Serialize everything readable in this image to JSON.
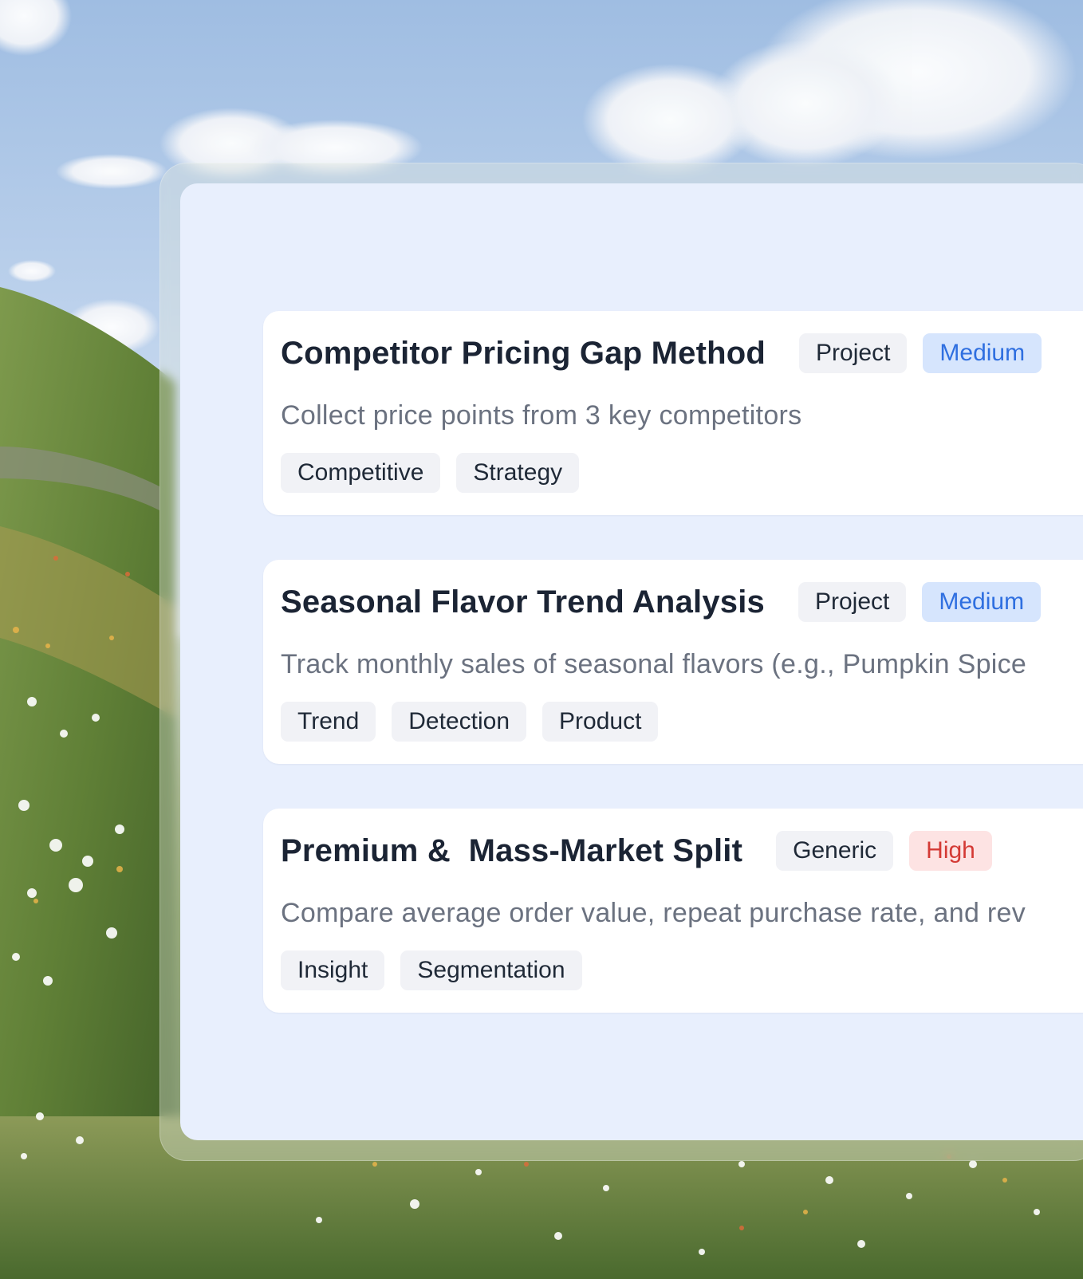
{
  "cards": [
    {
      "title": "Competitor Pricing Gap Method",
      "type_badge": "Project",
      "priority_badge": "Medium",
      "priority_color": "#2f6fe0",
      "description": "Collect price points from 3 key competitors",
      "tags": [
        "Competitive",
        "Strategy"
      ]
    },
    {
      "title": "Seasonal Flavor Trend Analysis",
      "type_badge": "Project",
      "priority_badge": "Medium",
      "priority_color": "#2f6fe0",
      "description": "Track monthly sales of seasonal flavors (e.g., Pumpkin Spice",
      "tags": [
        "Trend",
        "Detection",
        "Product"
      ]
    },
    {
      "title": "Premium &  Mass-Market Split",
      "type_badge": "Generic",
      "priority_badge": "High",
      "priority_color": "#d43a35",
      "description": "Compare average order value, repeat purchase rate, and rev",
      "tags": [
        "Insight",
        "Segmentation"
      ]
    }
  ]
}
